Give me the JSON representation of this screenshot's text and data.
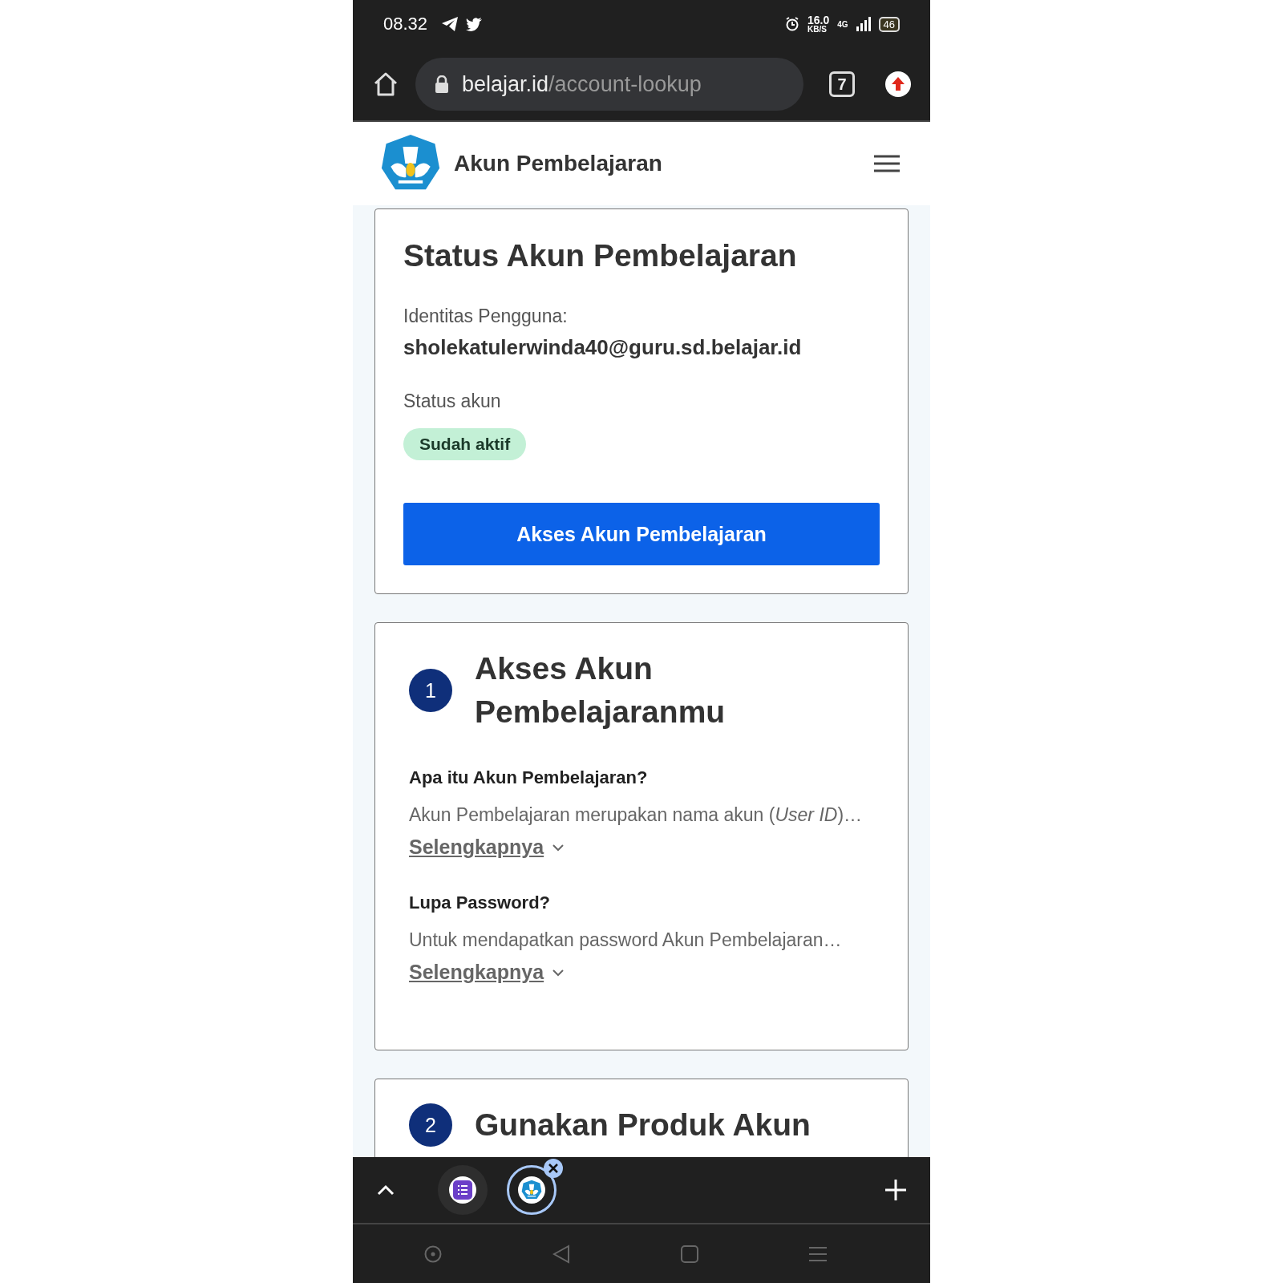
{
  "status_bar": {
    "time": "08.32",
    "speed": "16.0",
    "speed_unit": "KB/S",
    "network": "4G",
    "battery": "46"
  },
  "browser": {
    "url_host": "belajar.id",
    "url_path": "/account-lookup",
    "tab_count": "7"
  },
  "header": {
    "title": "Akun Pembelajaran"
  },
  "status_card": {
    "title": "Status Akun Pembelajaran",
    "identity_label": "Identitas Pengguna:",
    "identity_value": "sholekatulerwinda40@guru.sd.belajar.id",
    "status_label": "Status akun",
    "badge": "Sudah aktif",
    "button": "Akses Akun Pembelajaran"
  },
  "guide_cards": [
    {
      "number": "1",
      "title": "Akses Akun Pembelajaranmu",
      "faqs": [
        {
          "question": "Apa itu Akun Pembelajaran?",
          "summary": "Akun Pembelajaran merupakan nama akun (*User ID*)…",
          "more": "Selengkapnya",
          "expanded": false
        },
        {
          "question": "Lupa Password?",
          "summary": "Untuk mendapatkan password Akun Pembelajaran…",
          "more": "Selengkapnya",
          "expanded": false
        }
      ]
    },
    {
      "number": "2",
      "title": "Gunakan Produk Akun"
    }
  ],
  "tab_strip": {
    "tabs": [
      {
        "kind": "list",
        "selected": false
      },
      {
        "kind": "logo",
        "selected": true
      }
    ]
  }
}
